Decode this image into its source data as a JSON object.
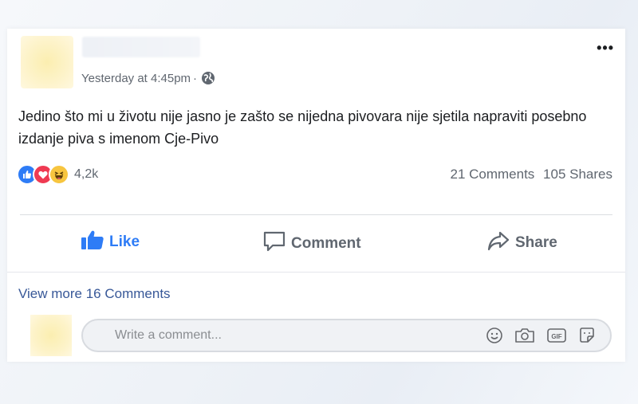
{
  "post": {
    "timestamp": "Yesterday at 4:45pm",
    "separator": "·",
    "more_label": "•••",
    "text": "Jedino što mi u životu nije jasno je zašto se nijedna pivovara nije sjetila napraviti posebno izdanje piva s imenom Cje-Pivo",
    "icons": [
      "globe-icon",
      "more-icon"
    ]
  },
  "reactions": {
    "types": [
      "like",
      "love",
      "haha"
    ],
    "count": "4,2k",
    "colors": {
      "like": "#2e7cf6",
      "love": "#ef3a52",
      "haha": "#f7c53f"
    }
  },
  "stats": {
    "comments": "21 Comments",
    "shares": "105 Shares"
  },
  "actions": {
    "like": "Like",
    "comment": "Comment",
    "share": "Share"
  },
  "comments": {
    "view_more": "View more 16 Comments",
    "placeholder": "Write a comment...",
    "icons": [
      "emoji-icon",
      "camera-icon",
      "gif-icon",
      "sticker-icon"
    ]
  },
  "theme": {
    "accent": "#2e7cf6",
    "link": "#385898",
    "muted": "#606770"
  }
}
